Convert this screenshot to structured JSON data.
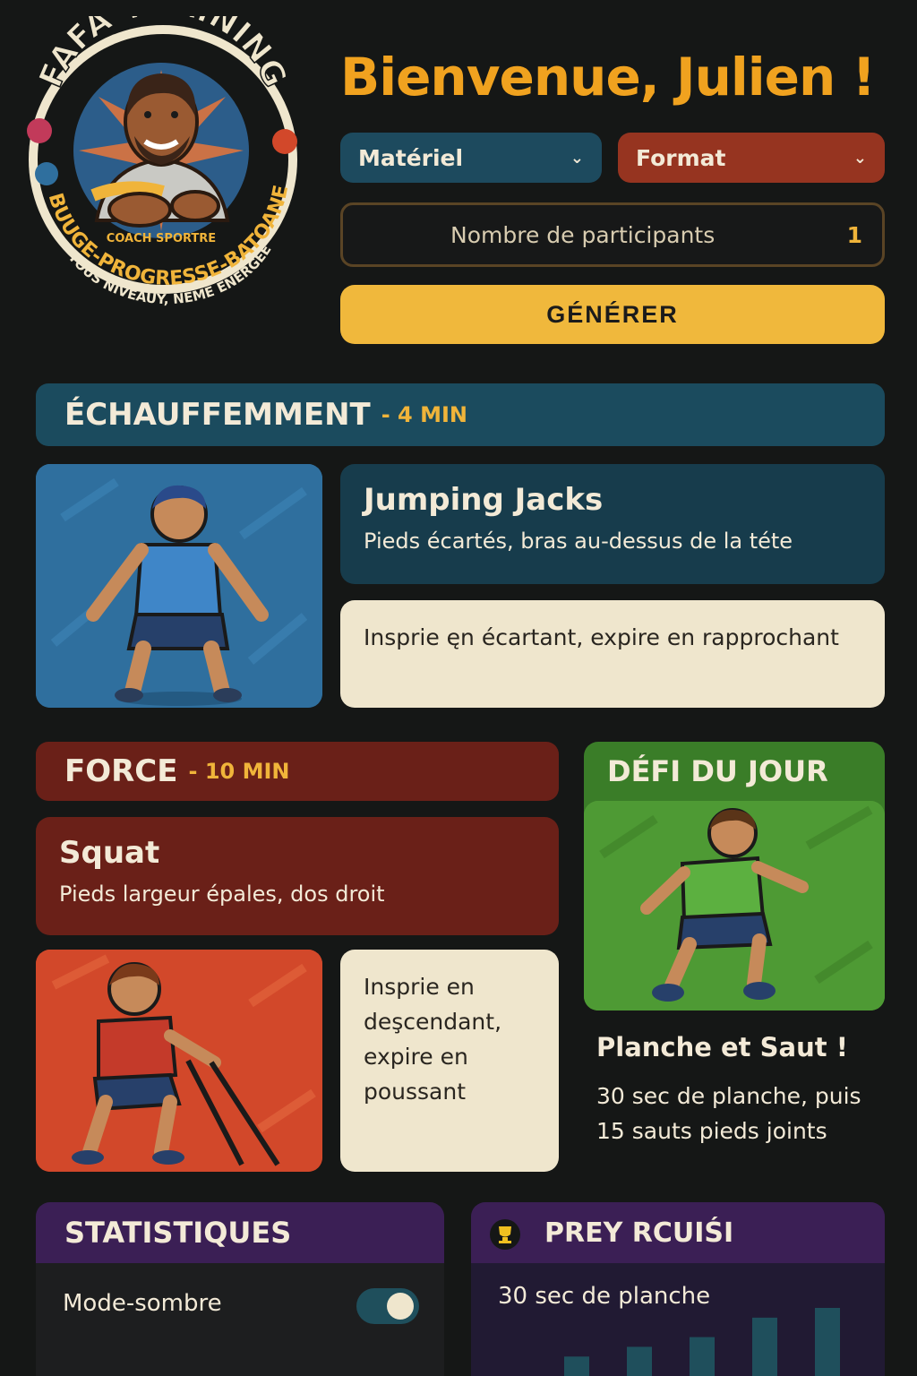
{
  "logo": {
    "brand": "FAFA TRAINING",
    "role": "COACH SPORTRE",
    "slogan": "BUUGE-PROGRESSE-BATOANE",
    "tagline": "TOUS NIVEAUY, NEME ENERGEE"
  },
  "header": {
    "welcome": "Bienvenue,  Julien !",
    "materiel_label": "Matériel",
    "format_label": "Format",
    "participants_label": "Nombre de participants",
    "participants_value": "1",
    "generate_label": "GÉNÉRER"
  },
  "warmup": {
    "title": "ÉCHAUFFEMMENT",
    "duration": "- 4 MIN",
    "exercise_name": "Jumping Jacks",
    "exercise_desc": "Pieds écartés, bras au-dessus de la téte",
    "breathing": "Insprie ęn écartant, expire en rapprochant"
  },
  "force": {
    "title": "FORCE",
    "duration": "- 10 MIN",
    "exercise_name": "Squat",
    "exercise_desc": "Pieds largeur épales, dos droit",
    "breathing": "Insprie en deşcendant, expire en poussant"
  },
  "defi": {
    "title": "DÉFI DU JOUR",
    "challenge_name": "Planche et Saut !",
    "challenge_desc": "30 sec de planche, puis 15 sauts pieds joints"
  },
  "stats": {
    "title": "STATISTIQUES",
    "dark_mode_label": "Mode-sombre",
    "dark_mode_on": true
  },
  "progress": {
    "title": "PREY RCUIŚI",
    "item_label": "30 sec de planche",
    "bars": [
      2,
      3,
      4,
      6,
      7
    ]
  },
  "colors": {
    "accent_orange": "#f0a21f",
    "accent_yellow": "#f0b83c",
    "teal": "#1b4b5e",
    "red": "#6a2018",
    "green": "#4e9a34",
    "purple": "#3b1f55"
  }
}
